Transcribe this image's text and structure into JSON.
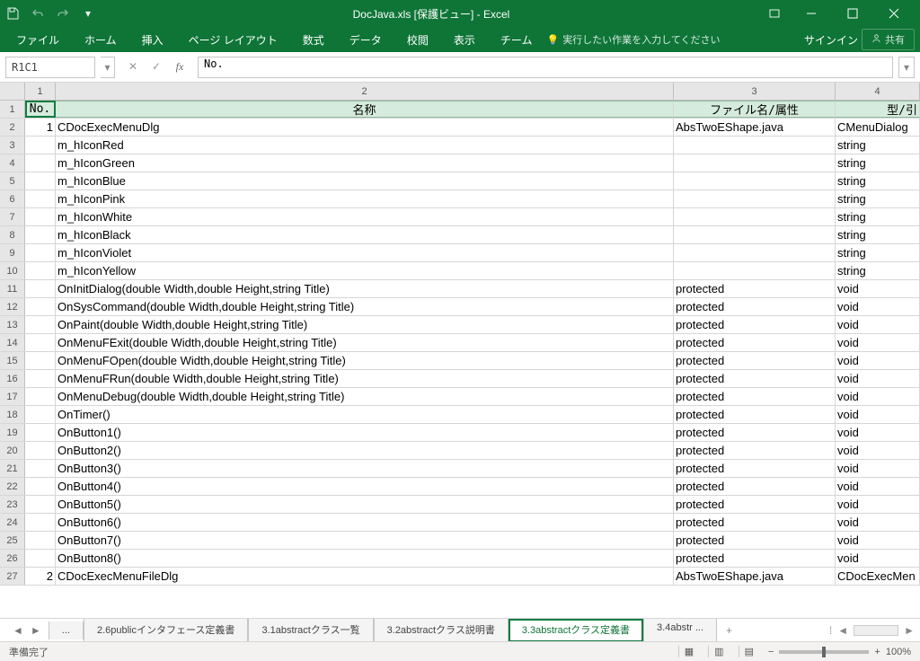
{
  "titlebar": {
    "title": "DocJava.xls  [保護ビュー] - Excel"
  },
  "ribbon": {
    "tabs": [
      "ファイル",
      "ホーム",
      "挿入",
      "ページ レイアウト",
      "数式",
      "データ",
      "校閲",
      "表示",
      "チーム"
    ],
    "tell": "実行したい作業を入力してください",
    "signin": "サインイン",
    "share": "共有"
  },
  "formulabar": {
    "namebox": "R1C1",
    "value": "No."
  },
  "columns": {
    "c1": "1",
    "c2": "2",
    "c3": "3",
    "c4": "4"
  },
  "headers": {
    "no": "No.",
    "name": "名称",
    "file": "ファイル名/属性",
    "type": "型/引"
  },
  "rows": [
    {
      "r": 2,
      "no": "1",
      "name": "CDocExecMenuDlg",
      "file": "AbsTwoEShape.java",
      "type": "CMenuDialog"
    },
    {
      "r": 3,
      "no": "",
      "name": "m_hIconRed",
      "file": "",
      "type": "string"
    },
    {
      "r": 4,
      "no": "",
      "name": "m_hIconGreen",
      "file": "",
      "type": "string"
    },
    {
      "r": 5,
      "no": "",
      "name": "m_hIconBlue",
      "file": "",
      "type": "string"
    },
    {
      "r": 6,
      "no": "",
      "name": "m_hIconPink",
      "file": "",
      "type": "string"
    },
    {
      "r": 7,
      "no": "",
      "name": "m_hIconWhite",
      "file": "",
      "type": "string"
    },
    {
      "r": 8,
      "no": "",
      "name": "m_hIconBlack",
      "file": "",
      "type": "string"
    },
    {
      "r": 9,
      "no": "",
      "name": "m_hIconViolet",
      "file": "",
      "type": "string"
    },
    {
      "r": 10,
      "no": "",
      "name": "m_hIconYellow",
      "file": "",
      "type": "string"
    },
    {
      "r": 11,
      "no": "",
      "name": "OnInitDialog(double Width,double Height,string Title)",
      "file": "protected",
      "type": "void"
    },
    {
      "r": 12,
      "no": "",
      "name": "OnSysCommand(double Width,double Height,string Title)",
      "file": "protected",
      "type": "void"
    },
    {
      "r": 13,
      "no": "",
      "name": "OnPaint(double Width,double Height,string Title)",
      "file": "protected",
      "type": "void"
    },
    {
      "r": 14,
      "no": "",
      "name": "OnMenuFExit(double Width,double Height,string Title)",
      "file": "protected",
      "type": "void"
    },
    {
      "r": 15,
      "no": "",
      "name": "OnMenuFOpen(double Width,double Height,string Title)",
      "file": "protected",
      "type": "void"
    },
    {
      "r": 16,
      "no": "",
      "name": "OnMenuFRun(double Width,double Height,string Title)",
      "file": "protected",
      "type": "void"
    },
    {
      "r": 17,
      "no": "",
      "name": "OnMenuDebug(double Width,double Height,string Title)",
      "file": "protected",
      "type": "void"
    },
    {
      "r": 18,
      "no": "",
      "name": "OnTimer()",
      "file": "protected",
      "type": "void"
    },
    {
      "r": 19,
      "no": "",
      "name": "OnButton1()",
      "file": "protected",
      "type": "void"
    },
    {
      "r": 20,
      "no": "",
      "name": "OnButton2()",
      "file": "protected",
      "type": "void"
    },
    {
      "r": 21,
      "no": "",
      "name": "OnButton3()",
      "file": "protected",
      "type": "void"
    },
    {
      "r": 22,
      "no": "",
      "name": "OnButton4()",
      "file": "protected",
      "type": "void"
    },
    {
      "r": 23,
      "no": "",
      "name": "OnButton5()",
      "file": "protected",
      "type": "void"
    },
    {
      "r": 24,
      "no": "",
      "name": "OnButton6()",
      "file": "protected",
      "type": "void"
    },
    {
      "r": 25,
      "no": "",
      "name": "OnButton7()",
      "file": "protected",
      "type": "void"
    },
    {
      "r": 26,
      "no": "",
      "name": "OnButton8()",
      "file": "protected",
      "type": "void"
    },
    {
      "r": 27,
      "no": "2",
      "name": "CDocExecMenuFileDlg",
      "file": "AbsTwoEShape.java",
      "type": "CDocExecMen"
    }
  ],
  "sheets": {
    "ellipsis": "...",
    "tabs": [
      {
        "label": "2.6publicインタフェース定義書",
        "active": false
      },
      {
        "label": "3.1abstractクラス一覧",
        "active": false
      },
      {
        "label": "3.2abstractクラス説明書",
        "active": false
      },
      {
        "label": "3.3abstractクラス定義書",
        "active": true
      },
      {
        "label": "3.4abstr ...",
        "active": false
      }
    ],
    "add": "+"
  },
  "statusbar": {
    "ready": "準備完了",
    "zoom": "100%"
  }
}
